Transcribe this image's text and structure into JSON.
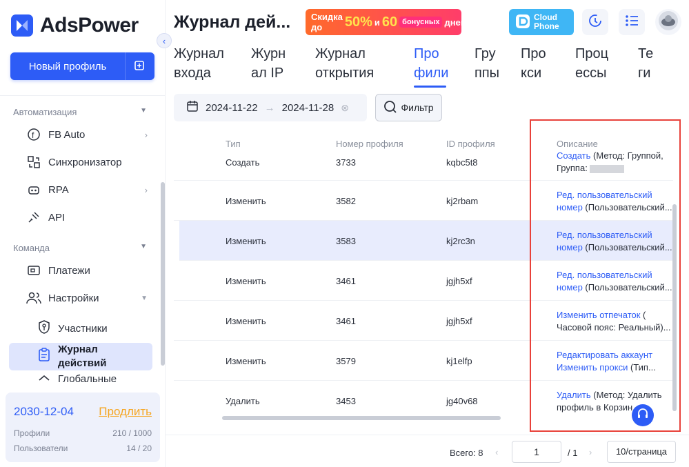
{
  "sidebar": {
    "brand": "AdsPower",
    "new_profile": "Новый профиль",
    "groups": [
      {
        "label": "Автоматизация"
      },
      {
        "label": "Команда"
      }
    ],
    "items": [
      {
        "label": "FB Auto"
      },
      {
        "label": "Синхронизатор"
      },
      {
        "label": "RPA"
      },
      {
        "label": "API"
      },
      {
        "label": "Платежи"
      },
      {
        "label": "Настройки"
      }
    ],
    "subitems": [
      {
        "label": "Участники"
      },
      {
        "label": "Журнал действий"
      },
      {
        "label": "Глобальные"
      }
    ],
    "plan": {
      "date": "2030-12-04",
      "renew": "Продлить",
      "profiles_label": "Профили",
      "profiles_value": "210 / 1000",
      "users_label": "Пользователи",
      "users_value": "14 / 20"
    }
  },
  "header": {
    "title": "Журнал дей...",
    "promo": {
      "pre": "Скидка до",
      "pct": "50%",
      "and": "и",
      "num": "60",
      "badge": "бонусных",
      "post": "дней"
    },
    "cloud": {
      "line1": "Cloud",
      "line2": "Phone"
    }
  },
  "tabs": [
    {
      "line1": "Журнал",
      "line2": "входа"
    },
    {
      "line1": "Журн",
      "line2": "ал IP"
    },
    {
      "line1": "Журнал",
      "line2": "открытия"
    },
    {
      "line1": "Про",
      "line2": "фили"
    },
    {
      "line1": "Гру",
      "line2": "ппы"
    },
    {
      "line1": "Про",
      "line2": "кси"
    },
    {
      "line1": "Проц",
      "line2": "ессы"
    },
    {
      "line1": "Те",
      "line2": "ги"
    }
  ],
  "filters": {
    "date_from": "2024-11-22",
    "date_to": "2024-11-28",
    "filter_label": "Фильтр"
  },
  "table": {
    "columns": [
      "Тип",
      "Номер профиля",
      "ID профиля",
      "Описание"
    ],
    "rows": [
      {
        "type": "Создать",
        "number": "3733",
        "id": "kqbc5t8",
        "d1_link": "Создать",
        "d1_text": " (Метод: Группой,",
        "d2_link": "",
        "d2_text": "Группа: "
      },
      {
        "type": "Изменить",
        "number": "3582",
        "id": "kj2rbam",
        "d1_link": "Ред. пользовательский",
        "d1_text": "",
        "d2_link": "номер",
        "d2_text": " (Пользовательский..."
      },
      {
        "type": "Изменить",
        "number": "3583",
        "id": "kj2rc3n",
        "d1_link": "Ред. пользовательский",
        "d1_text": "",
        "d2_link": "номер",
        "d2_text": " (Пользовательский..."
      },
      {
        "type": "Изменить",
        "number": "3461",
        "id": "jgjh5xf",
        "d1_link": "Ред. пользовательский",
        "d1_text": "",
        "d2_link": "номер",
        "d2_text": " (Пользовательский..."
      },
      {
        "type": "Изменить",
        "number": "3461",
        "id": "jgjh5xf",
        "d1_link": "Изменить отпечаток",
        "d1_text": " (",
        "d2_link": "",
        "d2_text": "Часовой пояс: Реальный)..."
      },
      {
        "type": "Изменить",
        "number": "3579",
        "id": "kj1elfp",
        "d1_link": "Редактировать аккаунт",
        "d1_text": "",
        "d2_link": "Изменить прокси",
        "d2_text": " (Тип..."
      },
      {
        "type": "Удалить",
        "number": "3453",
        "id": "jg40v68",
        "d1_link": "Удалить",
        "d1_text": " (Метод: Удалить",
        "d2_link": "",
        "d2_text": "профиль в Корзин..."
      }
    ]
  },
  "pager": {
    "total": "Всего: 8",
    "page": "1",
    "of": "/ 1",
    "size": "10/страница"
  },
  "colors": {
    "accent": "#2d5cf6",
    "highlight_row": "#e8ecfd",
    "annotation": "#e8413a",
    "renew": "#f5a623"
  }
}
